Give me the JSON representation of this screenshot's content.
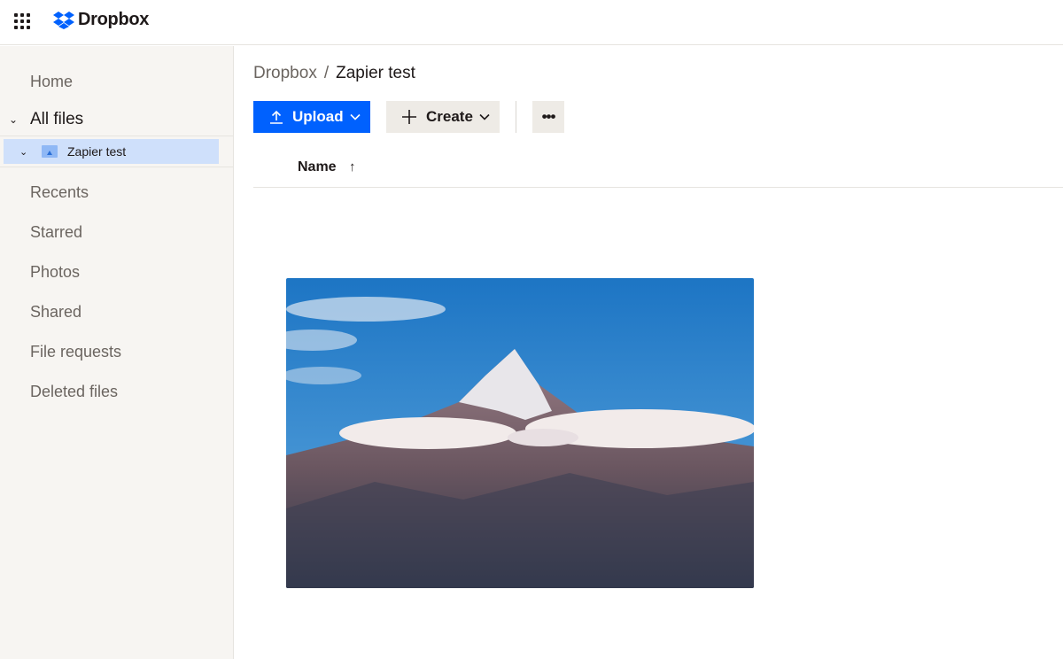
{
  "header": {
    "brand": "Dropbox",
    "apps_icon": "grid-icon",
    "logo_icon": "dropbox-logo"
  },
  "sidebar": {
    "items": [
      {
        "label": "Home"
      },
      {
        "label": "All files",
        "expanded": true
      },
      {
        "label": "Recents"
      },
      {
        "label": "Starred"
      },
      {
        "label": "Photos"
      },
      {
        "label": "Shared"
      },
      {
        "label": "File requests"
      },
      {
        "label": "Deleted files"
      }
    ],
    "tree": {
      "label": "Zapier test",
      "selected": true,
      "icon": "photo-folder-icon"
    }
  },
  "breadcrumb": {
    "root": "Dropbox",
    "separator": "/",
    "current": "Zapier test"
  },
  "toolbar": {
    "upload_label": "Upload",
    "create_label": "Create",
    "more_label": "•••"
  },
  "list": {
    "column_name": "Name",
    "sort": "ascending"
  },
  "colors": {
    "accent": "#0061fe",
    "selected": "#cfe0fb",
    "sidebar_bg": "#f7f5f2"
  }
}
